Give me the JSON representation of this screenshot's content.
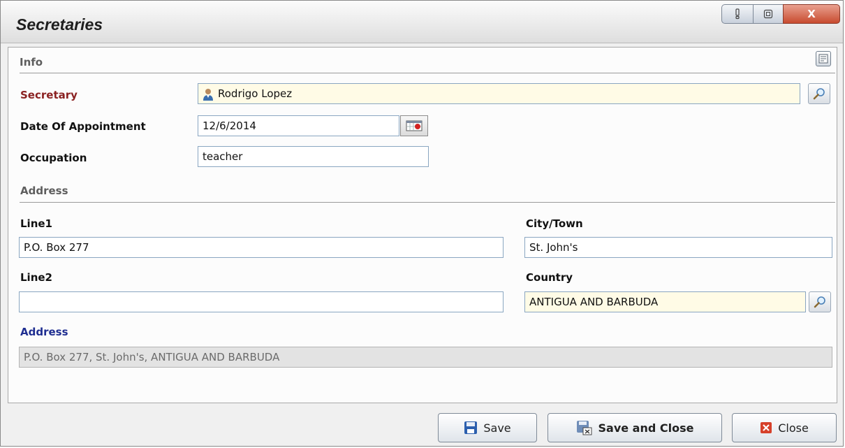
{
  "window": {
    "title": "Secretaries",
    "help_icon": "exclamation-icon",
    "restore_icon": "restore-icon",
    "close_glyph": "X"
  },
  "info": {
    "heading": "Info",
    "secretary_label": "Secretary",
    "secretary_value": "Rodrigo Lopez",
    "date_label": "Date Of Appointment",
    "date_value": "12/6/2014",
    "occupation_label": "Occupation",
    "occupation_value": "teacher"
  },
  "address": {
    "heading": "Address",
    "line1_label": "Line1",
    "line1_value": "P.O. Box 277",
    "line2_label": "Line2",
    "line2_value": "",
    "city_label": "City/Town",
    "city_value": "St. John's",
    "country_label": "Country",
    "country_value": "ANTIGUA AND BARBUDA",
    "full_label": "Address",
    "full_value": "P.O. Box 277, St. John's, ANTIGUA AND BARBUDA"
  },
  "buttons": {
    "save": "Save",
    "save_close": "Save and Close",
    "close": "Close"
  },
  "colors": {
    "required_label": "#8b2222",
    "computed_label": "#1f2e91",
    "lookup_bg": "#fffbe6",
    "close_red": "#c84b2f"
  }
}
